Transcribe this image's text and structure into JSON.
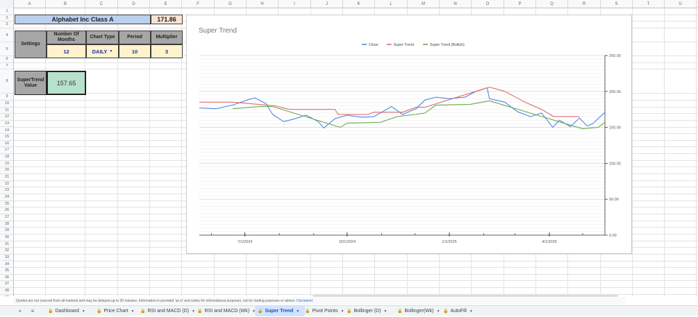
{
  "columns": [
    "A",
    "B",
    "C",
    "D",
    "E",
    "F",
    "G",
    "H",
    "I",
    "J",
    "K",
    "L",
    "M",
    "N",
    "O",
    "P",
    "Q",
    "R",
    "S",
    "T",
    "U"
  ],
  "rows": [
    "1",
    "2",
    "3",
    "4",
    "5",
    "6",
    "7",
    "8",
    "9",
    "10",
    "11",
    "12",
    "13",
    "14",
    "15",
    "16",
    "17",
    "18",
    "19",
    "20",
    "21",
    "22",
    "23",
    "24",
    "25",
    "26",
    "27",
    "28",
    "29",
    "30",
    "31",
    "32",
    "33",
    "34",
    "35",
    "36",
    "37",
    "38",
    "39"
  ],
  "sheet": {
    "title": "Alphabet Inc Class A",
    "price": "171.86",
    "settings_label": "Settings",
    "headers": {
      "months": "Number Of Months",
      "chart_type": "Chart Type",
      "period": "Period",
      "multiplier": "Multiplier"
    },
    "values": {
      "months": "12",
      "chart_type": "DAILY",
      "period": "10",
      "multiplier": "3"
    },
    "supertrend_label": "SuperTrend Value",
    "supertrend_value": "157.65"
  },
  "chart_data": {
    "type": "line",
    "title": "Super Trend",
    "legend_position": "top-center",
    "ylim": [
      0,
      250
    ],
    "y_ticks": [
      "0.00",
      "50.00",
      "100.00",
      "150.00",
      "200.00",
      "250.00"
    ],
    "x_ticks": [
      "7/1/2024",
      "10/1/2024",
      "1/1/2025",
      "4/1/2025"
    ],
    "x_range": [
      "2024-05-21",
      "2025-05-21"
    ],
    "series": [
      {
        "name": "Close",
        "color": "#4a86e8",
        "points": [
          [
            "2024-05-21",
            177
          ],
          [
            "2024-06-05",
            176
          ],
          [
            "2024-06-20",
            181
          ],
          [
            "2024-07-05",
            189
          ],
          [
            "2024-07-10",
            191
          ],
          [
            "2024-07-20",
            183
          ],
          [
            "2024-07-26",
            168
          ],
          [
            "2024-08-05",
            158
          ],
          [
            "2024-08-15",
            162
          ],
          [
            "2024-08-25",
            167
          ],
          [
            "2024-09-05",
            158
          ],
          [
            "2024-09-10",
            149
          ],
          [
            "2024-09-20",
            162
          ],
          [
            "2024-10-01",
            167
          ],
          [
            "2024-10-15",
            164
          ],
          [
            "2024-10-25",
            165
          ],
          [
            "2024-11-01",
            171
          ],
          [
            "2024-11-10",
            179
          ],
          [
            "2024-11-20",
            168
          ],
          [
            "2024-12-02",
            176
          ],
          [
            "2024-12-10",
            188
          ],
          [
            "2024-12-20",
            192
          ],
          [
            "2025-01-01",
            190
          ],
          [
            "2025-01-15",
            192
          ],
          [
            "2025-01-25",
            200
          ],
          [
            "2025-02-04",
            205
          ],
          [
            "2025-02-06",
            190
          ],
          [
            "2025-02-20",
            185
          ],
          [
            "2025-03-03",
            172
          ],
          [
            "2025-03-15",
            165
          ],
          [
            "2025-03-25",
            170
          ],
          [
            "2025-04-04",
            150
          ],
          [
            "2025-04-10",
            160
          ],
          [
            "2025-04-20",
            151
          ],
          [
            "2025-04-28",
            163
          ],
          [
            "2025-05-05",
            152
          ],
          [
            "2025-05-10",
            155
          ],
          [
            "2025-05-21",
            171
          ]
        ]
      },
      {
        "name": "Super Trend",
        "color": "#e06666",
        "points": [
          [
            "2024-05-21",
            185
          ],
          [
            "2024-06-10",
            185
          ],
          [
            "2024-06-20",
            185
          ],
          [
            "2024-07-28",
            180
          ],
          [
            "2024-08-10",
            175
          ],
          [
            "2024-09-20",
            175
          ],
          [
            "2024-09-23",
            168
          ],
          [
            "2024-10-20",
            168
          ],
          [
            "2024-10-25",
            171
          ],
          [
            "2024-11-20",
            171
          ],
          [
            "2024-12-02",
            178
          ],
          [
            "2024-12-10",
            178
          ],
          [
            "2025-02-06",
            206
          ],
          [
            "2025-02-20",
            200
          ],
          [
            "2025-03-10",
            185
          ],
          [
            "2025-03-25",
            175
          ],
          [
            "2025-04-05",
            165
          ],
          [
            "2025-04-25",
            165
          ],
          [
            "2025-04-28",
            165
          ]
        ]
      },
      {
        "name": "Super Trend (Bullish)",
        "color": "#6aa84f",
        "points": [
          [
            "2024-06-20",
            176
          ],
          [
            "2024-07-15",
            179
          ],
          [
            "2024-07-26",
            179
          ],
          [
            "2024-09-25",
            150
          ],
          [
            "2024-10-01",
            156
          ],
          [
            "2024-10-31",
            157
          ],
          [
            "2024-11-15",
            165
          ],
          [
            "2024-12-01",
            168
          ],
          [
            "2024-12-10",
            170
          ],
          [
            "2024-12-20",
            181
          ],
          [
            "2025-01-20",
            182
          ],
          [
            "2025-02-06",
            187
          ],
          [
            "2025-05-01",
            148
          ],
          [
            "2025-05-15",
            150
          ],
          [
            "2025-05-21",
            157
          ]
        ]
      }
    ]
  },
  "footer": {
    "disclaimer": "Quotes are not sourced from all markets and may be delayed up to 20 minutes. Information is provided 'as is' and solely for informational purposes, not for trading purposes or advice.",
    "disclaimer_link": "Disclaimer"
  },
  "tabs": {
    "add_icon": "+",
    "menu_icon": "≡",
    "items": [
      {
        "label": "Dashboard",
        "icon": "lock-icon",
        "active": false
      },
      {
        "label": "Price Chart",
        "icon": "lock-icon",
        "active": false
      },
      {
        "label": "RSI and MACD (D)",
        "icon": "lock-icon",
        "active": false
      },
      {
        "label": "RSI and MACD (Wk)",
        "icon": "lock-icon",
        "active": false
      },
      {
        "label": "Super Trend",
        "icon": "lock-icon",
        "active": true
      },
      {
        "label": "Pivot Points",
        "icon": "lock-icon",
        "active": false
      },
      {
        "label": "Bollinger (D)",
        "icon": "lock-icon",
        "active": false
      },
      {
        "label": "Bollinger(Wk)",
        "icon": "lock-icon",
        "active": false
      },
      {
        "label": "AutoFill",
        "icon": "lock-icon",
        "active": false
      }
    ]
  }
}
